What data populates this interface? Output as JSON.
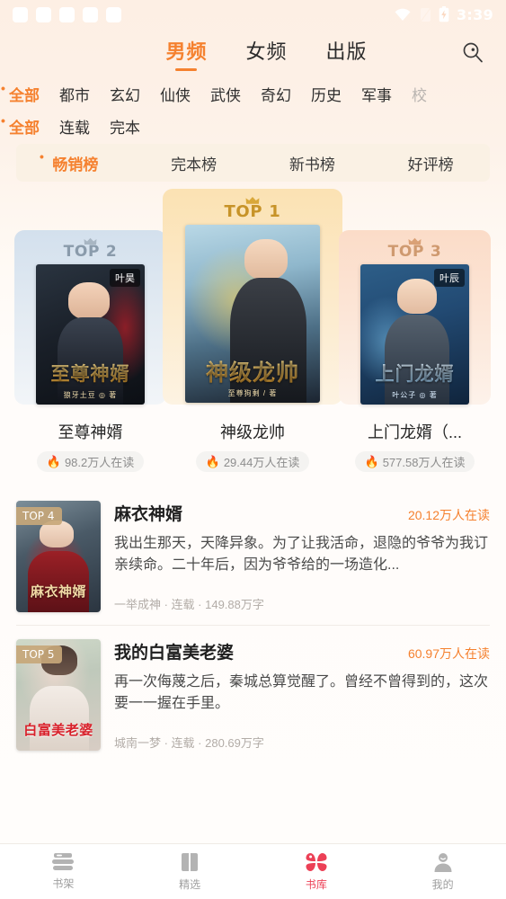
{
  "status_bar": {
    "time": "3:39",
    "icons": [
      "wifi-icon",
      "signal-icon",
      "battery-charging-icon"
    ],
    "placeholder_count": 5
  },
  "header": {
    "tabs": [
      {
        "label": "男频",
        "active": true
      },
      {
        "label": "女频",
        "active": false
      },
      {
        "label": "出版",
        "active": false
      }
    ],
    "search_icon": "search-icon"
  },
  "filters": {
    "genre_row": [
      {
        "label": "全部",
        "active": true
      },
      {
        "label": "都市",
        "active": false
      },
      {
        "label": "玄幻",
        "active": false
      },
      {
        "label": "仙侠",
        "active": false
      },
      {
        "label": "武侠",
        "active": false
      },
      {
        "label": "奇幻",
        "active": false
      },
      {
        "label": "历史",
        "active": false
      },
      {
        "label": "军事",
        "active": false
      },
      {
        "label": "校",
        "active": false,
        "cut_off": true
      }
    ],
    "status_row": [
      {
        "label": "全部",
        "active": true
      },
      {
        "label": "连载",
        "active": false
      },
      {
        "label": "完本",
        "active": false
      }
    ]
  },
  "rank_tabs": [
    {
      "label": "畅销榜",
      "active": true
    },
    {
      "label": "完本榜",
      "active": false
    },
    {
      "label": "新书榜",
      "active": false
    },
    {
      "label": "好评榜",
      "active": false
    }
  ],
  "podium": [
    {
      "rank_label": "TOP 2",
      "title": "至尊神婿",
      "cover_title": "至尊神婿",
      "cover_author": "狼牙土豆 ◎ 著",
      "pen_tag": "叶昊",
      "readers": "98.2万人在读",
      "flame": "🔥"
    },
    {
      "rank_label": "TOP 1",
      "title": "神级龙帅",
      "cover_title": "神级龙帅",
      "cover_author": "至尊狗剩 / 著",
      "pen_tag": "",
      "readers": "29.44万人在读",
      "flame": "🔥"
    },
    {
      "rank_label": "TOP 3",
      "title": "上门龙婿（...",
      "cover_title": "上门龙婿",
      "cover_author": "叶公子 ◎ 著",
      "pen_tag": "叶辰",
      "readers": "577.58万人在读",
      "flame": "🔥"
    }
  ],
  "list": [
    {
      "badge": "TOP 4",
      "title": "麻衣神婿",
      "cover_title": "麻衣神婿",
      "readers": "20.12万人在读",
      "desc": "我出生那天，天降异象。为了让我活命，退隐的爷爷为我订亲续命。二十年后，因为爷爷给的一场造化...",
      "meta": "一举成神 · 连载 · 149.88万字"
    },
    {
      "badge": "TOP 5",
      "title": "我的白富美老婆",
      "cover_title": "白富美老婆",
      "readers": "60.97万人在读",
      "desc": "再一次侮蔑之后，秦城总算觉醒了。曾经不曾得到的，这次要一一握在手里。",
      "meta": "城南一梦 · 连载 · 280.69万字"
    }
  ],
  "bottom_nav": [
    {
      "label": "书架",
      "icon": "bookshelf-icon",
      "active": false
    },
    {
      "label": "精选",
      "icon": "book-open-icon",
      "active": false
    },
    {
      "label": "书库",
      "icon": "library-clover-icon",
      "active": true
    },
    {
      "label": "我的",
      "icon": "user-icon",
      "active": false
    }
  ],
  "colors": {
    "accent_orange": "#f5812f",
    "accent_pink": "#ec4056",
    "gold": "#c79328",
    "silver": "#8a9bab",
    "bronze": "#cf9a70"
  }
}
